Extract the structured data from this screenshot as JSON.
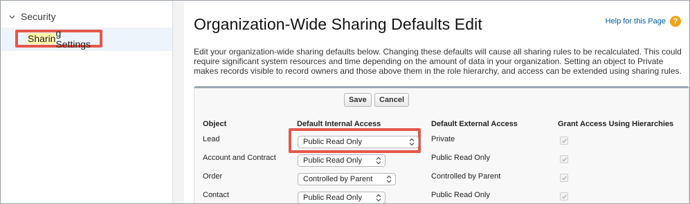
{
  "sidebar": {
    "parent_label": "Security",
    "child_label_highlight": "Sharin",
    "child_label_rest": "g Settings"
  },
  "main": {
    "title": "Organization-Wide Sharing Defaults Edit",
    "help_link": "Help for this Page",
    "description": "Edit your organization-wide sharing defaults below. Changing these defaults will cause all sharing rules to be recalculated. This could require significant system resources and time depending on the amount of data in your organization. Setting an object to Private makes records visible to record owners and those above them in the role hierarchy, and access can be extended using sharing rules."
  },
  "toolbar": {
    "save_label": "Save",
    "cancel_label": "Cancel"
  },
  "table": {
    "headers": [
      "Object",
      "Default Internal Access",
      "Default External Access",
      "Grant Access Using Hierarchies"
    ],
    "rows": [
      {
        "object": "Lead",
        "internal": "Public Read Only",
        "external": "Private",
        "grant": true
      },
      {
        "object": "Account and Contract",
        "internal": "Public Read Only",
        "external": "Public Read Only",
        "grant": true
      },
      {
        "object": "Order",
        "internal": "Controlled by Parent",
        "external": "Controlled by Parent",
        "grant": true
      },
      {
        "object": "Contact",
        "internal": "Public Read Only",
        "external": "Public Read Only",
        "grant": true
      }
    ]
  },
  "colors": {
    "highlight_border": "#e4574a",
    "link": "#015ba7",
    "help_icon": "#f0a418",
    "panel_top": "#9aa7b5"
  },
  "icons": {
    "nav_chevron": "chevron-down-icon",
    "help": "help-icon",
    "select": "select-caret-icon",
    "checkbox": "checkmark-icon"
  }
}
